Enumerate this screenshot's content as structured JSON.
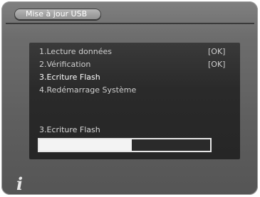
{
  "title": "Mise à jour USB",
  "steps": [
    {
      "label": "1.Lecture données",
      "status": "[OK]"
    },
    {
      "label": "2.Vérification",
      "status": "[OK]"
    },
    {
      "label": "3.Ecriture Flash",
      "status": ""
    },
    {
      "label": "4.Redémarrage Système",
      "status": ""
    }
  ],
  "progress": {
    "label": "3.Ecriture Flash",
    "fraction": 0.54
  },
  "footer": {
    "info_icon": "i"
  },
  "colors": {
    "frame": "#6d6d6d",
    "panel": "#2a2a2a",
    "active_text": "#ffffff",
    "inactive_text": "#cfcfcf",
    "progress_fill": "#f3f3f3"
  }
}
